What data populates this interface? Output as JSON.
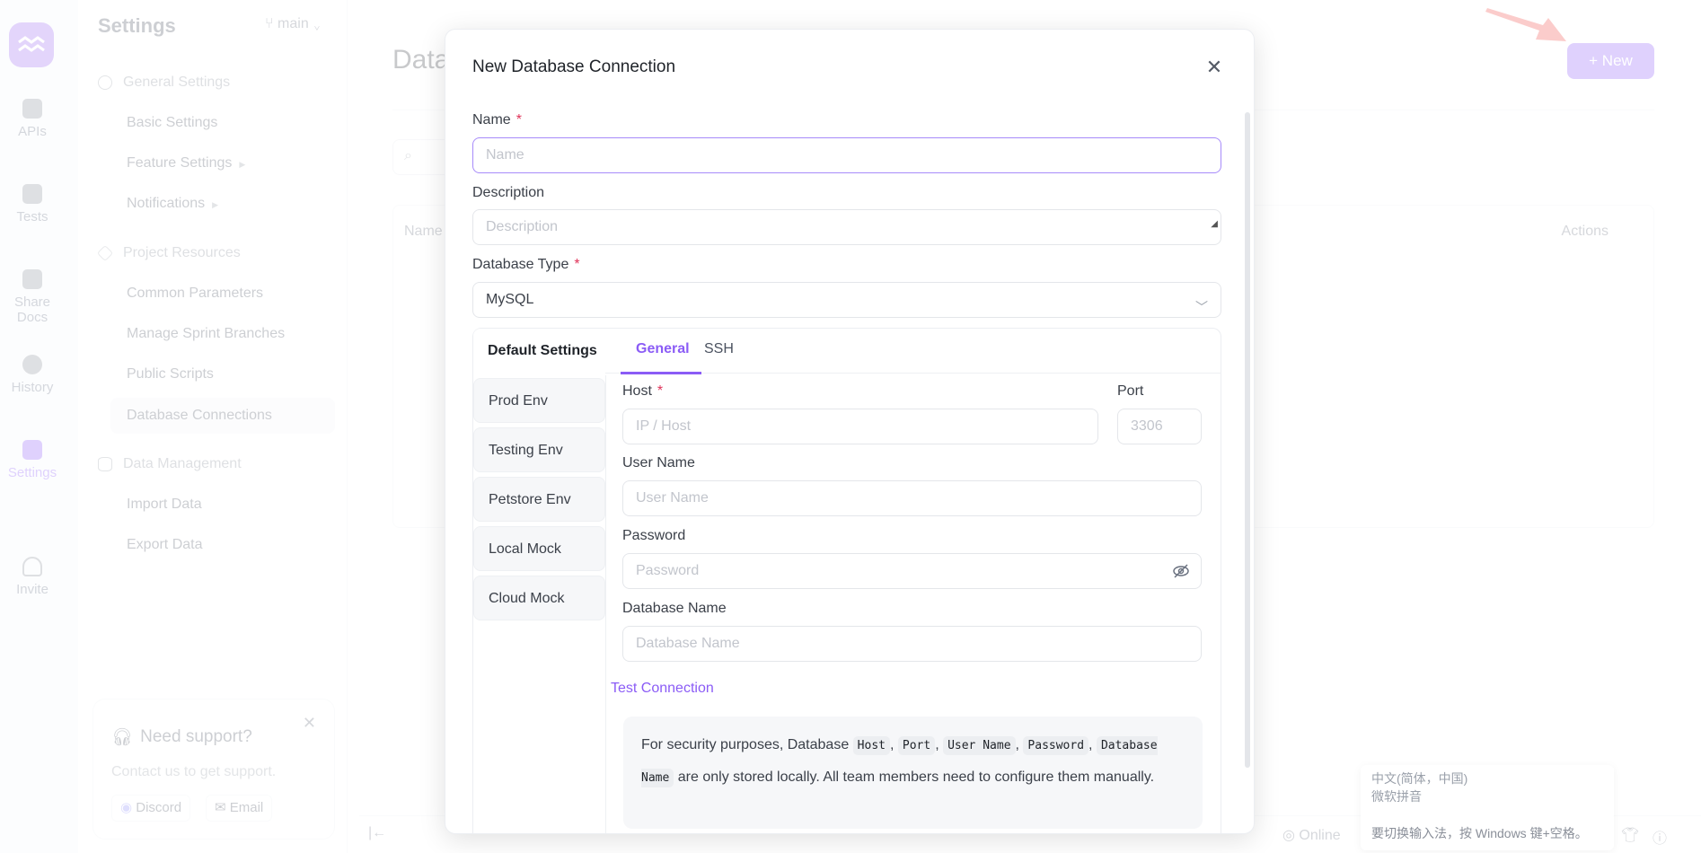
{
  "rail": {
    "items": [
      {
        "label": "APIs",
        "icon": "api-icon"
      },
      {
        "label": "Tests",
        "icon": "tests-icon"
      },
      {
        "label": "Share Docs",
        "icon": "share-docs-icon"
      },
      {
        "label": "History",
        "icon": "history-icon"
      },
      {
        "label": "Settings",
        "icon": "settings-icon",
        "active": true
      },
      {
        "label": "Invite",
        "icon": "invite-icon"
      }
    ]
  },
  "sidenav": {
    "title": "Settings",
    "branch": "main",
    "groups": [
      {
        "label": "General Settings",
        "icon": "gear-icon",
        "items": [
          "Basic Settings",
          "Feature Settings",
          "Notifications"
        ]
      },
      {
        "label": "Project Resources",
        "icon": "layers-icon",
        "items": [
          "Common Parameters",
          "Manage Sprint Branches",
          "Public Scripts",
          "Database Connections"
        ]
      },
      {
        "label": "Data Management",
        "icon": "database-icon",
        "items": [
          "Import Data",
          "Export Data"
        ]
      }
    ],
    "active_item": "Database Connections"
  },
  "support": {
    "title": "Need support?",
    "desc": "Contact us to get support.",
    "discord": "Discord",
    "email": "Email"
  },
  "main": {
    "title": "Database Connections",
    "new_button": "+ New",
    "table_headers": {
      "name": "Name",
      "actions": "Actions"
    }
  },
  "statusbar": {
    "online": "Online"
  },
  "modal": {
    "title": "New Database Connection",
    "name_label": "Name",
    "name_placeholder": "Name",
    "desc_label": "Description",
    "desc_placeholder": "Description",
    "dbtype_label": "Database Type",
    "dbtype_value": "MySQL",
    "env_tabs": [
      "Default Settings",
      "Prod Env",
      "Testing Env",
      "Petstore Env",
      "Local Mock",
      "Cloud Mock"
    ],
    "active_env": "Default Settings",
    "sub_tabs": [
      "General",
      "SSH"
    ],
    "active_sub_tab": "General",
    "host_label": "Host",
    "host_placeholder": "IP / Host",
    "port_label": "Port",
    "port_placeholder": "3306",
    "username_label": "User Name",
    "username_placeholder": "User Name",
    "password_label": "Password",
    "password_placeholder": "Password",
    "dbname_label": "Database Name",
    "dbname_placeholder": "Database Name",
    "test_connection": "Test Connection",
    "note": {
      "prefix": "For security purposes, Database",
      "codes": [
        "Host",
        "Port",
        "User Name",
        "Password",
        "Database Name"
      ],
      "suffix": "are only stored locally. All team members need to configure them manually."
    }
  },
  "ime": {
    "line1": "中文(简体，中国)",
    "line2": "微软拼音",
    "tip": "要切换输入法，按 Windows 键+空格。"
  },
  "colors": {
    "accent": "#8b5cf6",
    "required": "#e0345a",
    "annotation_arrow": "#f04a45"
  }
}
